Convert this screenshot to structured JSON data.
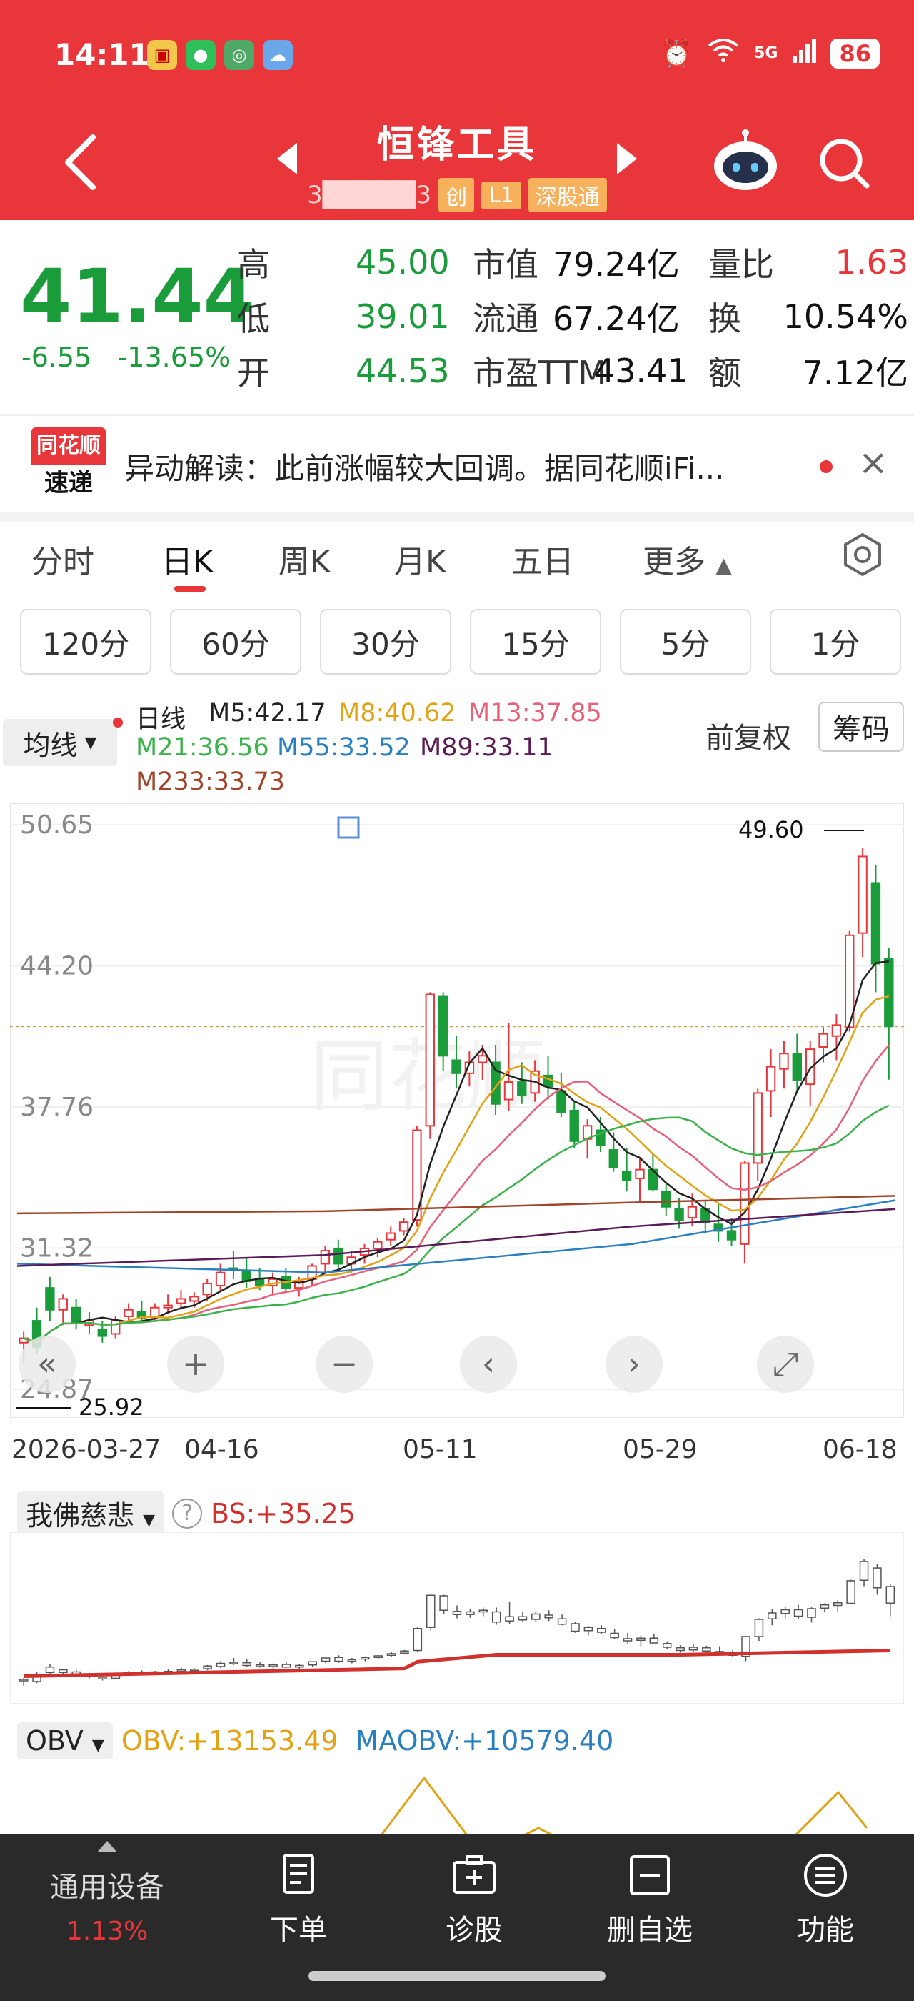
{
  "status_bar": {
    "time": "14:11",
    "network": "5G",
    "battery": "86"
  },
  "header": {
    "stock_name": "恒锋工具",
    "code": "3█████3",
    "tags": [
      "创",
      "L1",
      "深股通"
    ]
  },
  "quote": {
    "price": "41.44",
    "change": "-6.55",
    "change_pct": "-13.65%",
    "high_label": "高",
    "high": "45.00",
    "low_label": "低",
    "low": "39.01",
    "open_label": "开",
    "open": "44.53",
    "mcap_label": "市值",
    "mcap": "79.24亿",
    "float_label": "流通",
    "float": "67.24亿",
    "pe_label": "市盈TTM",
    "pe": "43.41",
    "vr_label": "量比",
    "vr": "1.63",
    "turnover_label": "换",
    "turnover": "10.54%",
    "amount_label": "额",
    "amount": "7.12亿"
  },
  "news": {
    "logo_top": "同花顺",
    "logo_bottom": "速递",
    "text": "异动解读：此前涨幅较大回调。据同花顺iFi..."
  },
  "tabs": [
    "分时",
    "日K",
    "周K",
    "月K",
    "五日",
    "更多"
  ],
  "periods": [
    "120分",
    "60分",
    "30分",
    "15分",
    "5分",
    "1分"
  ],
  "ma": {
    "select": "均线",
    "title": "日线",
    "m5": "M5:42.17",
    "m8": "M8:40.62",
    "m13": "M13:37.85",
    "m21": "M21:36.56",
    "m55": "M55:33.52",
    "m89": "M89:33.11",
    "m233": "M233:33.73",
    "fq": "前复权",
    "chouma": "筹码"
  },
  "chart_data": {
    "type": "candlestick",
    "y_ticks": [
      "50.65",
      "44.20",
      "37.76",
      "31.32",
      "24.87"
    ],
    "ylim": [
      24.87,
      50.65
    ],
    "max_label": "49.60",
    "min_label": "25.92",
    "dates": [
      "2026-03-27",
      "04-16",
      "05-11",
      "05-29",
      "06-18"
    ],
    "candles": [
      [
        27.0,
        27.5,
        26.0,
        27.2
      ],
      [
        28.0,
        28.6,
        26.5,
        26.8
      ],
      [
        29.5,
        30.0,
        28.0,
        28.5
      ],
      [
        28.5,
        29.2,
        27.8,
        29.0
      ],
      [
        28.6,
        29.0,
        27.6,
        27.9
      ],
      [
        27.8,
        28.4,
        27.4,
        28.0
      ],
      [
        27.6,
        28.0,
        27.0,
        27.3
      ],
      [
        27.4,
        28.2,
        27.2,
        28.0
      ],
      [
        28.2,
        28.8,
        27.9,
        28.5
      ],
      [
        28.4,
        28.9,
        28.0,
        28.1
      ],
      [
        28.2,
        28.8,
        28.0,
        28.6
      ],
      [
        28.6,
        29.2,
        28.3,
        28.7
      ],
      [
        28.8,
        29.4,
        28.5,
        29.0
      ],
      [
        28.9,
        29.3,
        28.6,
        29.1
      ],
      [
        29.2,
        29.9,
        28.9,
        29.7
      ],
      [
        29.6,
        30.6,
        29.3,
        30.2
      ],
      [
        30.4,
        31.2,
        29.9,
        30.3
      ],
      [
        30.3,
        30.9,
        29.5,
        29.8
      ],
      [
        29.9,
        30.4,
        29.4,
        29.6
      ],
      [
        29.6,
        30.2,
        29.2,
        29.9
      ],
      [
        30.0,
        30.4,
        29.3,
        29.5
      ],
      [
        29.5,
        30.0,
        29.1,
        29.8
      ],
      [
        29.9,
        30.6,
        29.6,
        30.5
      ],
      [
        30.6,
        31.4,
        30.2,
        31.2
      ],
      [
        31.3,
        31.7,
        30.3,
        30.6
      ],
      [
        30.6,
        31.2,
        30.2,
        30.9
      ],
      [
        31.0,
        31.5,
        30.6,
        31.3
      ],
      [
        31.3,
        31.8,
        30.9,
        31.6
      ],
      [
        31.7,
        32.3,
        31.4,
        32.0
      ],
      [
        32.1,
        32.7,
        31.9,
        32.5
      ],
      [
        32.6,
        36.9,
        32.3,
        36.7
      ],
      [
        36.9,
        43.0,
        36.3,
        42.9
      ],
      [
        42.8,
        43.0,
        39.4,
        40.1
      ],
      [
        39.9,
        41.0,
        38.6,
        39.3
      ],
      [
        39.3,
        40.3,
        38.7,
        39.8
      ],
      [
        39.8,
        40.6,
        39.0,
        40.1
      ],
      [
        39.8,
        40.6,
        37.4,
        37.9
      ],
      [
        38.1,
        41.6,
        37.6,
        38.9
      ],
      [
        38.9,
        39.8,
        37.9,
        38.3
      ],
      [
        38.4,
        39.9,
        38.0,
        39.4
      ],
      [
        39.2,
        40.1,
        38.1,
        38.7
      ],
      [
        38.5,
        39.3,
        37.3,
        37.5
      ],
      [
        37.6,
        38.0,
        35.9,
        36.2
      ],
      [
        36.3,
        37.2,
        35.4,
        36.9
      ],
      [
        36.7,
        37.3,
        35.7,
        36.0
      ],
      [
        35.8,
        36.6,
        34.8,
        35.0
      ],
      [
        34.8,
        35.9,
        33.9,
        34.4
      ],
      [
        34.5,
        35.4,
        33.4,
        34.9
      ],
      [
        34.9,
        35.6,
        33.9,
        34.0
      ],
      [
        33.9,
        34.3,
        32.8,
        33.2
      ],
      [
        33.1,
        33.6,
        32.2,
        32.6
      ],
      [
        32.7,
        33.8,
        32.3,
        33.2
      ],
      [
        33.1,
        33.5,
        32.0,
        32.5
      ],
      [
        32.4,
        33.4,
        31.6,
        32.1
      ],
      [
        32.1,
        32.7,
        31.4,
        31.7
      ],
      [
        31.5,
        35.3,
        30.6,
        35.2
      ],
      [
        35.2,
        38.6,
        34.4,
        38.4
      ],
      [
        38.5,
        40.4,
        37.3,
        39.6
      ],
      [
        39.5,
        40.8,
        38.6,
        40.2
      ],
      [
        40.2,
        41.1,
        38.5,
        39.0
      ],
      [
        38.8,
        40.8,
        37.8,
        40.4
      ],
      [
        40.5,
        41.4,
        39.8,
        41.1
      ],
      [
        41.0,
        42.0,
        39.9,
        41.5
      ],
      [
        41.4,
        45.8,
        41.2,
        45.6
      ],
      [
        45.7,
        49.6,
        44.6,
        49.2
      ],
      [
        47.99,
        48.8,
        43.0,
        44.3
      ],
      [
        44.53,
        45.0,
        39.01,
        41.44
      ]
    ]
  },
  "indicator1": {
    "name": "我佛慈悲",
    "value": "BS:+35.25"
  },
  "indicator2": {
    "name": "OBV",
    "obv": "OBV:+13153.49",
    "maobv": "MAOBV:+10579.40"
  },
  "bottom": {
    "left_label": "通用设备",
    "left_pct": "1.13%",
    "items": [
      "下单",
      "诊股",
      "删自选",
      "功能"
    ]
  },
  "colors": {
    "up": "#e8363a",
    "down": "#1b9c3a",
    "header": "#e8363a"
  }
}
